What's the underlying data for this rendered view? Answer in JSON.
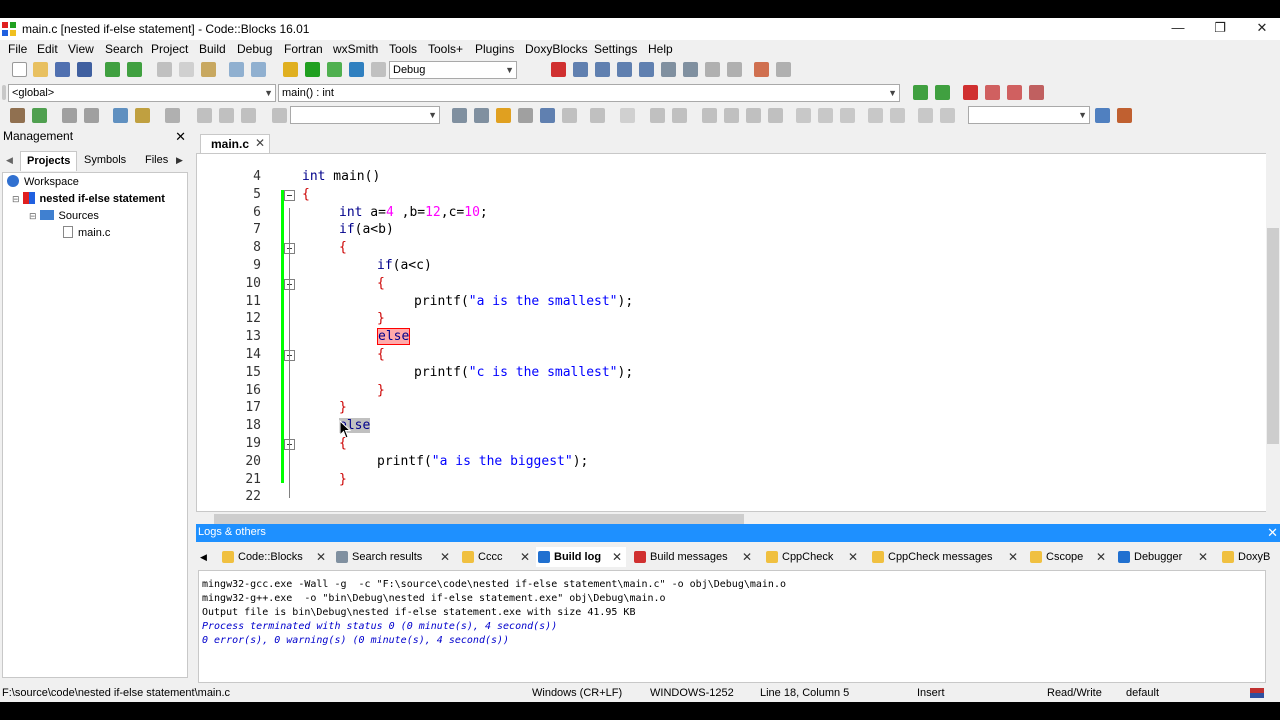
{
  "window": {
    "title": "main.c [nested if-else statement] - Code::Blocks 16.01"
  },
  "menu": [
    "File",
    "Edit",
    "View",
    "Search",
    "Project",
    "Build",
    "Debug",
    "Fortran",
    "wxSmith",
    "Tools",
    "Tools+",
    "Plugins",
    "DoxyBlocks",
    "Settings",
    "Help"
  ],
  "toolbar": {
    "build_target": "Debug",
    "scope": "<global>",
    "function": "main() : int"
  },
  "management": {
    "title": "Management",
    "tabs": [
      "Projects",
      "Symbols",
      "Files"
    ],
    "tree": {
      "workspace": "Workspace",
      "project": "nested if-else statement",
      "folder": "Sources",
      "file": "main.c"
    }
  },
  "editor": {
    "tab": "main.c",
    "lines": [
      {
        "n": "4",
        "code": "int main()"
      },
      {
        "n": "5",
        "code": "{"
      },
      {
        "n": "6",
        "code": "int a=4 ,b=12,c=10;"
      },
      {
        "n": "7",
        "code": "if(a<b)"
      },
      {
        "n": "8",
        "code": "{"
      },
      {
        "n": "9",
        "code": "if(a<c)"
      },
      {
        "n": "10",
        "code": "{"
      },
      {
        "n": "11",
        "code": "printf(\"a is the smallest\");"
      },
      {
        "n": "12",
        "code": "}"
      },
      {
        "n": "13",
        "code": "else"
      },
      {
        "n": "14",
        "code": "{"
      },
      {
        "n": "15",
        "code": "printf(\"c is the smallest\");"
      },
      {
        "n": "16",
        "code": "}"
      },
      {
        "n": "17",
        "code": "}"
      },
      {
        "n": "18",
        "code": "else"
      },
      {
        "n": "19",
        "code": "{"
      },
      {
        "n": "20",
        "code": "printf(\"a is the biggest\");"
      },
      {
        "n": "21",
        "code": "}"
      },
      {
        "n": "22",
        "code": ""
      }
    ]
  },
  "logs": {
    "title": "Logs & others",
    "tabs": [
      "Code::Blocks",
      "Search results",
      "Cccc",
      "Build log",
      "Build messages",
      "CppCheck",
      "CppCheck messages",
      "Cscope",
      "Debugger",
      "DoxyB"
    ],
    "active_tab": "Build log",
    "lines": [
      "mingw32-gcc.exe -Wall -g  -c \"F:\\source\\code\\nested if-else statement\\main.c\" -o obj\\Debug\\main.o",
      "mingw32-g++.exe  -o \"bin\\Debug\\nested if-else statement.exe\" obj\\Debug\\main.o",
      "Output file is bin\\Debug\\nested if-else statement.exe with size 41.95 KB",
      "Process terminated with status 0 (0 minute(s), 4 second(s))",
      "0 error(s), 0 warning(s) (0 minute(s), 4 second(s))"
    ]
  },
  "status": {
    "path": "F:\\source\\code\\nested if-else statement\\main.c",
    "eol": "Windows (CR+LF)",
    "encoding": "WINDOWS-1252",
    "position": "Line 18, Column 5",
    "mode": "Insert",
    "access": "Read/Write",
    "lang": "default"
  }
}
